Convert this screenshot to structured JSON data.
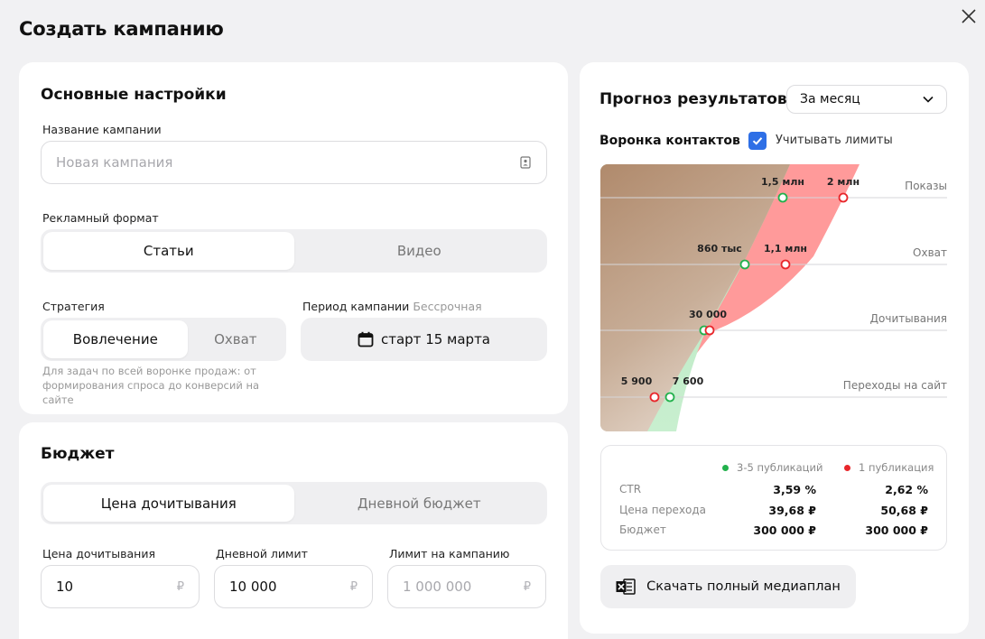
{
  "dialog": {
    "title": "Создать кампанию"
  },
  "basic": {
    "heading": "Основные настройки",
    "name_label": "Название кампании",
    "name_placeholder": "Новая кампания",
    "format_label": "Рекламный формат",
    "format_options": [
      "Статьи",
      "Видео"
    ],
    "format_selected": "Статьи",
    "strategy_label": "Стратегия",
    "strategy_options": [
      "Вовлечение",
      "Охват"
    ],
    "strategy_selected": "Вовлечение",
    "strategy_note": "Для задач по всей воронке продаж: от формирования спроса до конверсий на сайте",
    "period_label": "Период кампании",
    "period_hint": "Бессрочная",
    "period_value": "старт 15 марта"
  },
  "budget": {
    "heading": "Бюджет",
    "mode_options": [
      "Цена дочитывания",
      "Дневной бюджет"
    ],
    "mode_selected": "Цена дочитывания",
    "fields": [
      {
        "label": "Цена дочитывания",
        "value": "10",
        "placeholder": "",
        "currency": "₽"
      },
      {
        "label": "Дневной лимит",
        "value": "10 000",
        "placeholder": "",
        "currency": "₽"
      },
      {
        "label": "Лимит на кампанию",
        "value": "",
        "placeholder": "1 000 000",
        "currency": "₽"
      }
    ]
  },
  "forecast": {
    "heading": "Прогноз результатов",
    "period_select": "За месяц",
    "funnel_label": "Воронка контактов",
    "limits_checkbox_label": "Учитывать лимиты",
    "limits_checked": true,
    "colors": {
      "green": "#22b14c",
      "red": "#e8262b",
      "brown": "#b89478",
      "pink": "#ff9a9a"
    },
    "stages": [
      {
        "name": "Показы",
        "green_label": "1,5 млн",
        "red_label": "2 млн"
      },
      {
        "name": "Охват",
        "green_label": "860 тыс",
        "red_label": "1,1 млн"
      },
      {
        "name": "Дочитывания",
        "green_label": "30 000",
        "red_label": ""
      },
      {
        "name": "Переходы на сайт",
        "green_label": "7 600",
        "red_label": "5 900"
      }
    ],
    "legend": {
      "green": "3-5 публикаций",
      "red": "1 публикация"
    },
    "rows": [
      {
        "label": "CTR",
        "green": "3,59 %",
        "red": "2,62 %"
      },
      {
        "label": "Цена перехода",
        "green": "39,68 ₽",
        "red": "50,68 ₽"
      },
      {
        "label": "Бюджет",
        "green": "300 000 ₽",
        "red": "300 000 ₽"
      }
    ],
    "download_button": "Скачать полный медиаплан"
  }
}
